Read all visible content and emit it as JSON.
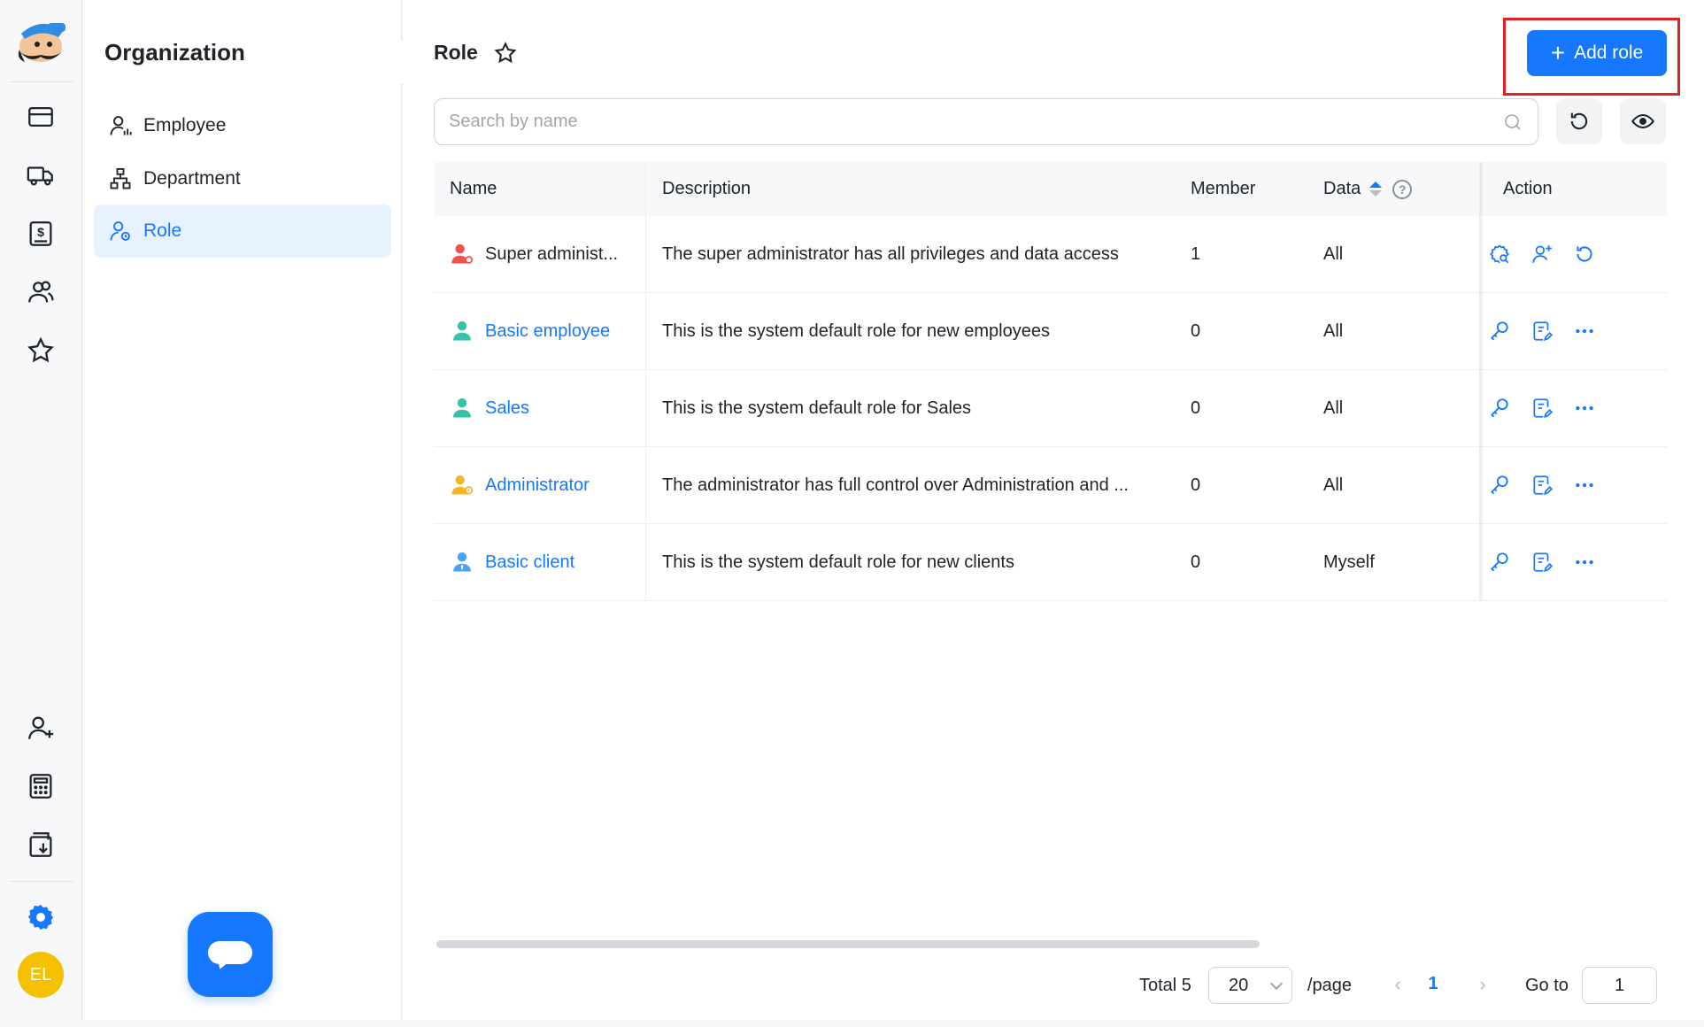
{
  "sidebar": {
    "title": "Organization",
    "items": [
      {
        "label": "Employee"
      },
      {
        "label": "Department"
      },
      {
        "label": "Role"
      }
    ]
  },
  "user": {
    "initials": "EL"
  },
  "header": {
    "title": "Role",
    "add_button": "Add role"
  },
  "search": {
    "placeholder": "Search by name",
    "value": ""
  },
  "table": {
    "columns": {
      "name": "Name",
      "description": "Description",
      "member": "Member",
      "data": "Data",
      "action": "Action"
    },
    "rows": [
      {
        "name": "Super administ...",
        "description": "The super administrator has all privileges and data access",
        "member": "1",
        "data": "All",
        "icon_color": "#f0514c"
      },
      {
        "name": "Basic employee",
        "description": "This is the system default role for new employees",
        "member": "0",
        "data": "All",
        "icon_color": "#36c2a6"
      },
      {
        "name": "Sales",
        "description": "This is the system default role for Sales",
        "member": "0",
        "data": "All",
        "icon_color": "#36c2a6"
      },
      {
        "name": "Administrator",
        "description": "The administrator has full control over Administration and ...",
        "member": "0",
        "data": "All",
        "icon_color": "#f7b52c"
      },
      {
        "name": "Basic client",
        "description": "This is the system default role for new clients",
        "member": "0",
        "data": "Myself",
        "icon_color": "#4aa3f5"
      }
    ]
  },
  "pagination": {
    "total": "Total 5",
    "page_size": "20",
    "per_page": "/page",
    "current": "1",
    "goto_label": "Go to",
    "goto_value": "1"
  },
  "colors": {
    "accent": "#1677ff",
    "highlight": "#e02424"
  }
}
